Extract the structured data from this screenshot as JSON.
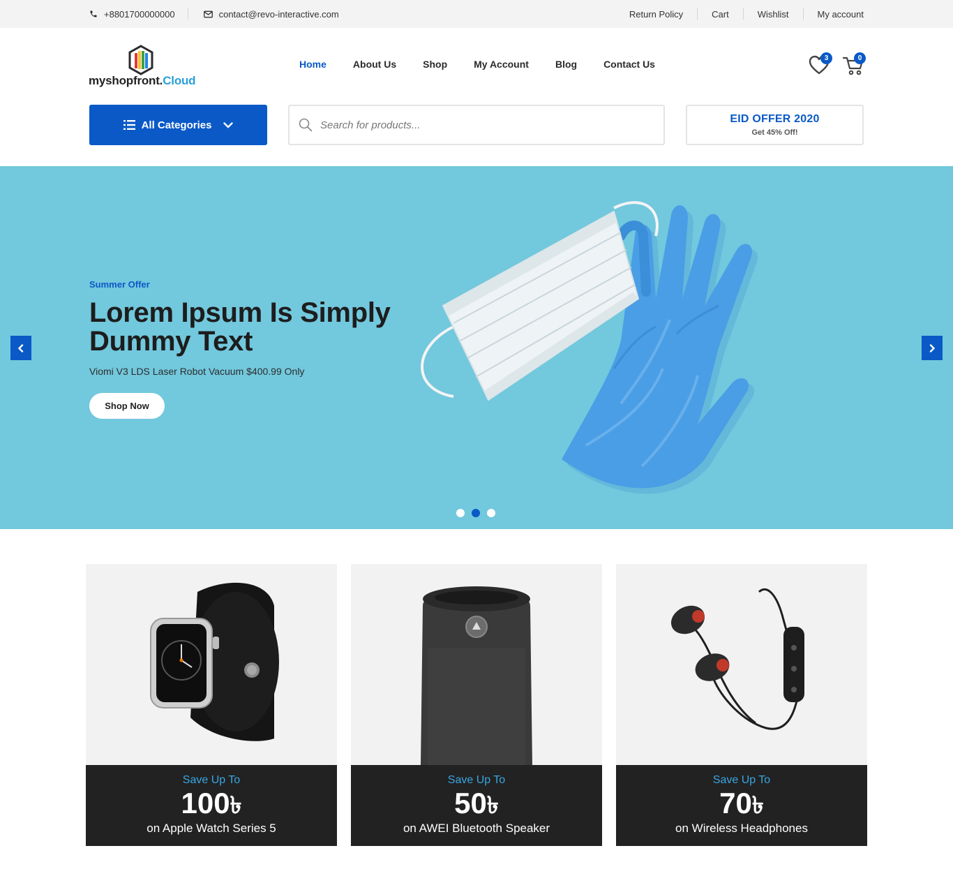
{
  "topbar": {
    "phone": "+8801700000000",
    "email": "contact@revo-interactive.com",
    "links": [
      "Return Policy",
      "Cart",
      "Wishlist",
      "My account"
    ]
  },
  "header": {
    "logo_main": "myshopfront.",
    "logo_accent": "Cloud",
    "nav": [
      "Home",
      "About Us",
      "Shop",
      "My Account",
      "Blog",
      "Contact Us"
    ],
    "wishlist_count": "3",
    "cart_count": "0"
  },
  "search_row": {
    "categories_label": "All Categories",
    "search_placeholder": "Search for products...",
    "offer_title": "EID OFFER 2020",
    "offer_sub": "Get 45% Off!"
  },
  "hero": {
    "eyebrow": "Summer Offer",
    "title": "Lorem Ipsum Is Simply Dummy Text",
    "subtitle": "Viomi V3 LDS Laser Robot Vacuum $400.99 Only",
    "button": "Shop Now",
    "slides": 3,
    "active_slide": 2
  },
  "promos": [
    {
      "save": "Save Up To",
      "amount": "100",
      "currency": "৳",
      "desc": "on Apple Watch Series 5"
    },
    {
      "save": "Save Up To",
      "amount": "50",
      "currency": "৳",
      "desc": "on AWEI Bluetooth Speaker"
    },
    {
      "save": "Save Up To",
      "amount": "70",
      "currency": "৳",
      "desc": "on Wireless Headphones"
    }
  ],
  "colors": {
    "brand": "#0a59c7",
    "hero_bg": "#72c8dd",
    "accent_text": "#39a6e3",
    "card_footer": "#222222"
  }
}
